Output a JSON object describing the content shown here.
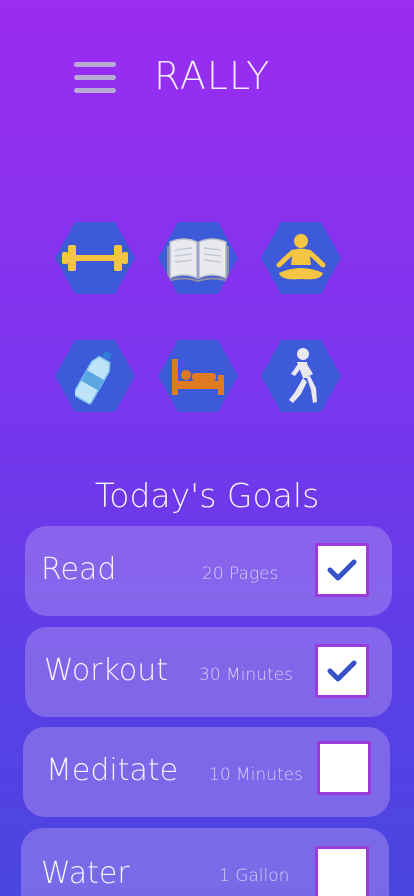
{
  "app": {
    "title": "RALLY"
  },
  "colors": {
    "hex_bg": "#3d5ad8",
    "accent": "#9a3cdc",
    "check": "#3552c8"
  },
  "icons": [
    {
      "name": "dumbbell-icon"
    },
    {
      "name": "book-icon"
    },
    {
      "name": "meditation-icon"
    },
    {
      "name": "water-bottle-icon"
    },
    {
      "name": "bed-icon"
    },
    {
      "name": "walking-icon"
    }
  ],
  "goals": {
    "title": "Today's Goals",
    "items": [
      {
        "name": "Read",
        "amount": "20 Pages",
        "checked": true
      },
      {
        "name": "Workout",
        "amount": "30 Minutes",
        "checked": true
      },
      {
        "name": "Meditate",
        "amount": "10 Minutes",
        "checked": false
      },
      {
        "name": "Water",
        "amount": "1 Gallon",
        "checked": false
      }
    ]
  }
}
